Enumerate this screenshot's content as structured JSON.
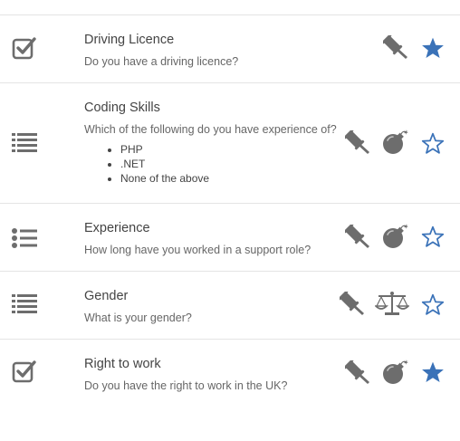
{
  "colors": {
    "icon_gray": "#6d6d6d",
    "star_blue": "#3a72b8",
    "divider": "#e4e4e4"
  },
  "questions": [
    {
      "title": "Driving Licence",
      "description": "Do you have a driving licence?",
      "type_icon": "checkbox-icon",
      "actions": [
        "gavel-icon",
        "star-filled-icon"
      ],
      "starred": true
    },
    {
      "title": "Coding Skills",
      "description": "Which of the following do you have experience of?",
      "type_icon": "list-icon",
      "options": [
        "PHP",
        ".NET",
        "None of the above"
      ],
      "actions": [
        "gavel-icon",
        "bomb-icon",
        "star-outline-icon"
      ],
      "starred": false
    },
    {
      "title": "Experience",
      "description": "How long have you worked in a support role?",
      "type_icon": "bulleted-list-icon",
      "actions": [
        "gavel-icon",
        "bomb-icon",
        "star-outline-icon"
      ],
      "starred": false
    },
    {
      "title": "Gender",
      "description": "What is your gender?",
      "type_icon": "list-icon",
      "actions": [
        "gavel-icon",
        "balance-scale-icon",
        "star-outline-icon"
      ],
      "starred": false
    },
    {
      "title": "Right to work",
      "description": "Do you have the right to work in the UK?",
      "type_icon": "checkbox-icon",
      "actions": [
        "gavel-icon",
        "bomb-icon",
        "star-filled-icon"
      ],
      "starred": true
    }
  ]
}
